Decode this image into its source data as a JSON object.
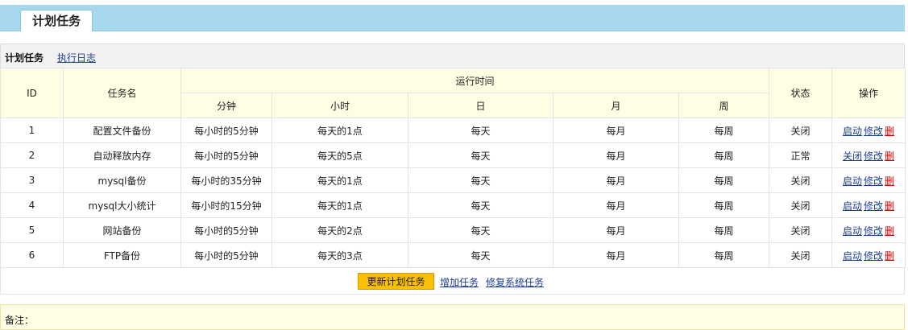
{
  "header": {
    "tab_title": "计划任务"
  },
  "subnav": {
    "title": "计划任务",
    "log_link": "执行日志"
  },
  "table": {
    "col_id": "ID",
    "col_name": "任务名",
    "col_runtime": "运行时间",
    "col_minute": "分钟",
    "col_hour": "小时",
    "col_day": "日",
    "col_month": "月",
    "col_week": "周",
    "col_status": "状态",
    "col_ops": "操作",
    "rows": [
      {
        "id": "1",
        "name": "配置文件备份",
        "minute": "每小时的5分钟",
        "hour": "每天的1点",
        "day": "每天",
        "month": "每月",
        "week": "每周",
        "status": "关闭",
        "toggle": "启动",
        "edit": "修改",
        "delete": "删"
      },
      {
        "id": "2",
        "name": "自动释放内存",
        "minute": "每小时的5分钟",
        "hour": "每天的5点",
        "day": "每天",
        "month": "每月",
        "week": "每周",
        "status": "正常",
        "toggle": "关闭",
        "edit": "修改",
        "delete": "删"
      },
      {
        "id": "3",
        "name": "mysql备份",
        "minute": "每小时的35分钟",
        "hour": "每天的1点",
        "day": "每天",
        "month": "每月",
        "week": "每周",
        "status": "关闭",
        "toggle": "启动",
        "edit": "修改",
        "delete": "删"
      },
      {
        "id": "4",
        "name": "mysql大小统计",
        "minute": "每小时的15分钟",
        "hour": "每天的1点",
        "day": "每天",
        "month": "每月",
        "week": "每周",
        "status": "关闭",
        "toggle": "启动",
        "edit": "修改",
        "delete": "删"
      },
      {
        "id": "5",
        "name": "网站备份",
        "minute": "每小时的5分钟",
        "hour": "每天的2点",
        "day": "每天",
        "month": "每月",
        "week": "每周",
        "status": "关闭",
        "toggle": "启动",
        "edit": "修改",
        "delete": "删"
      },
      {
        "id": "6",
        "name": "FTP备份",
        "minute": "每小时的5分钟",
        "hour": "每天的3点",
        "day": "每天",
        "month": "每月",
        "week": "每周",
        "status": "关闭",
        "toggle": "启动",
        "edit": "修改",
        "delete": "删"
      }
    ]
  },
  "actions": {
    "update_button": "更新计划任务",
    "add_task": "增加任务",
    "repair_system": "修复系统任务"
  },
  "notes": {
    "label": "备注："
  },
  "colors": {
    "topbar": "#a8d8ee",
    "header_bg": "#fffde4",
    "update_button": "#f8c000",
    "link": "#1a3f8f",
    "delete_link": "#d80000"
  }
}
